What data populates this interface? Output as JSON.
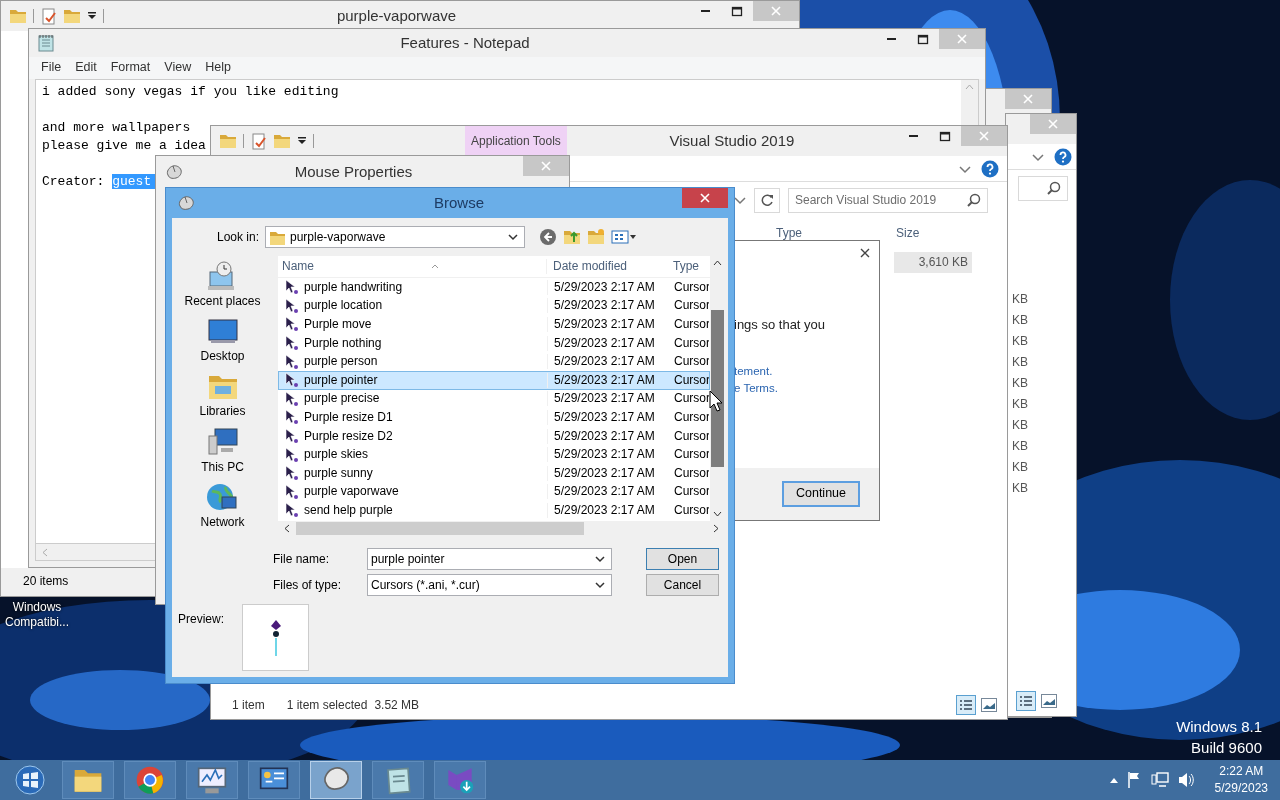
{
  "desktop_icon": {
    "label": "Windows Compatibi..."
  },
  "os_version": [
    "Windows 8.1",
    "Build 9600"
  ],
  "side_window": {
    "sizes": [
      "KB",
      "KB",
      "KB",
      "KB",
      "KB",
      "KB",
      "KB",
      "KB",
      "KB",
      "KB"
    ]
  },
  "explorer_window": {
    "title": "purple-vaporwave",
    "status": "20 items"
  },
  "notepad": {
    "title": "Features - Notepad",
    "menu": [
      "File",
      "Edit",
      "Format",
      "View",
      "Help"
    ],
    "paragraphs": [
      [
        "i added sony vegas if you like editing"
      ],
      [
        "and more wallpapers",
        "please give me a idea"
      ]
    ],
    "last_line": {
      "text": "Creator:",
      "selection": "guest"
    }
  },
  "vs_window": {
    "title": "Visual Studio 2019",
    "context_tab": "Application Tools",
    "search": {
      "placeholder": "Search Visual Studio 2019"
    },
    "columns": [
      "Type",
      "Size"
    ],
    "row_size": "3,610 KB",
    "status": [
      "1 item",
      "1 item selected",
      "3.52 MB"
    ]
  },
  "consent_dialog": {
    "text": "ings so that you",
    "links": [
      "tement.",
      "e Terms."
    ],
    "button": "Continue"
  },
  "mouse_properties": {
    "title": "Mouse Properties"
  },
  "browse": {
    "title": "Browse",
    "look_in": {
      "label": "Look in:",
      "value": "purple-vaporwave"
    },
    "places": [
      {
        "kind": "recent",
        "label": "Recent places"
      },
      {
        "kind": "desktop",
        "label": "Desktop"
      },
      {
        "kind": "libraries",
        "label": "Libraries"
      },
      {
        "kind": "pc",
        "label": "This PC"
      },
      {
        "kind": "network",
        "label": "Network"
      }
    ],
    "columns": [
      "Name",
      "Date modified",
      "Type"
    ],
    "files": [
      {
        "name": "purple handwriting",
        "date": "5/29/2023 2:17 AM",
        "type": "Cursor",
        "selected": false
      },
      {
        "name": "purple location",
        "date": "5/29/2023 2:17 AM",
        "type": "Cursor",
        "selected": false
      },
      {
        "name": "Purple move",
        "date": "5/29/2023 2:17 AM",
        "type": "Cursor",
        "selected": false
      },
      {
        "name": "Purple nothing",
        "date": "5/29/2023 2:17 AM",
        "type": "Cursor",
        "selected": false
      },
      {
        "name": "purple person",
        "date": "5/29/2023 2:17 AM",
        "type": "Cursor",
        "selected": false
      },
      {
        "name": "purple pointer",
        "date": "5/29/2023 2:17 AM",
        "type": "Cursor",
        "selected": true
      },
      {
        "name": "purple precise",
        "date": "5/29/2023 2:17 AM",
        "type": "Cursor",
        "selected": false
      },
      {
        "name": "Purple resize D1",
        "date": "5/29/2023 2:17 AM",
        "type": "Cursor",
        "selected": false
      },
      {
        "name": "Purple resize D2",
        "date": "5/29/2023 2:17 AM",
        "type": "Cursor",
        "selected": false
      },
      {
        "name": "purple skies",
        "date": "5/29/2023 2:17 AM",
        "type": "Cursor",
        "selected": false
      },
      {
        "name": "purple sunny",
        "date": "5/29/2023 2:17 AM",
        "type": "Cursor",
        "selected": false
      },
      {
        "name": "purple vaporwave",
        "date": "5/29/2023 2:17 AM",
        "type": "Cursor",
        "selected": false
      },
      {
        "name": "send help purple",
        "date": "5/29/2023 2:17 AM",
        "type": "Cursor",
        "selected": false
      }
    ],
    "file_name": {
      "label": "File name:",
      "value": "purple pointer"
    },
    "file_type": {
      "label": "Files of type:",
      "value": "Cursors (*.ani, *.cur)"
    },
    "buttons": [
      {
        "label": "Open",
        "default": true
      },
      {
        "label": "Cancel",
        "default": false
      }
    ],
    "preview_label": "Preview:"
  },
  "taskbar": {
    "apps": [
      {
        "kind": "explorer",
        "selected": false
      },
      {
        "kind": "browser",
        "selected": false
      },
      {
        "kind": "monitor",
        "selected": false
      },
      {
        "kind": "control_panel",
        "selected": false
      },
      {
        "kind": "mouse",
        "selected": true
      },
      {
        "kind": "notepad",
        "selected": false
      },
      {
        "kind": "installer",
        "selected": false
      }
    ],
    "clock": {
      "time": "2:22 AM",
      "date": "5/29/2023"
    }
  }
}
